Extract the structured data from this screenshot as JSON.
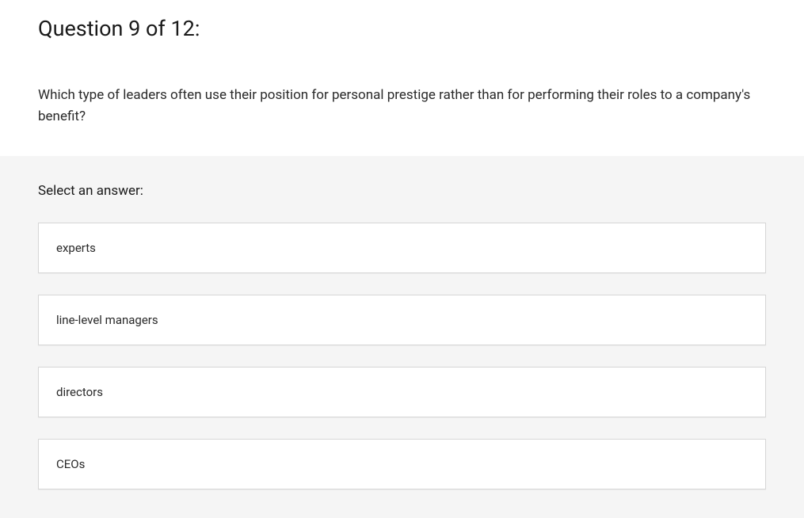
{
  "question": {
    "number_label": "Question 9 of 12:",
    "prompt": "Which type of leaders often use their position for personal prestige rather than for performing their roles to a company's benefit?"
  },
  "answer": {
    "select_label": "Select an answer:",
    "options": [
      "experts",
      "line-level managers",
      "directors",
      "CEOs"
    ]
  }
}
